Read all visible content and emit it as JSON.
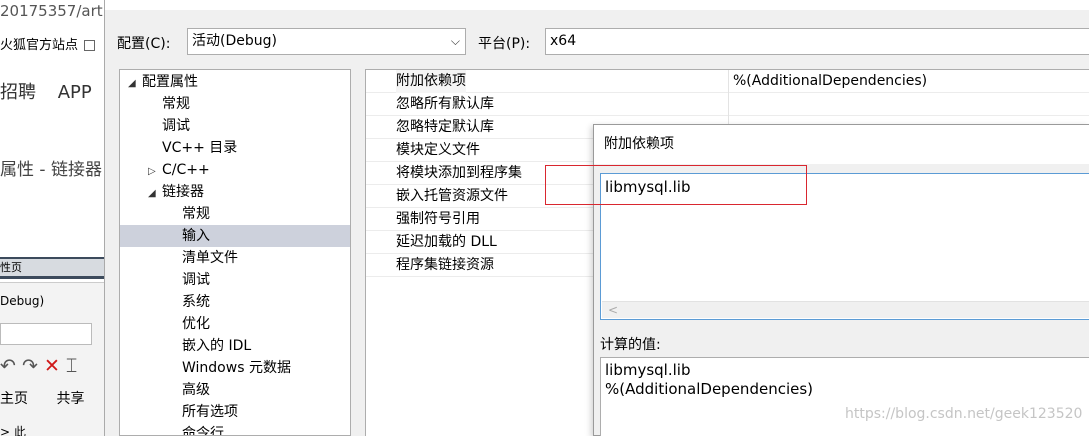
{
  "background": {
    "url_fragment": "20175357/art",
    "bookmark": "火狐官方站点",
    "nav": [
      "招聘",
      "APP"
    ],
    "heading": "属性 - 链接器",
    "darkbar_title": "性页",
    "debug_text": "Debug)",
    "ribbon": [
      "主页",
      "共享"
    ],
    "address": "> 此"
  },
  "toolbar": {
    "config_label": "配置(C):",
    "config_value": "活动(Debug)",
    "platform_label": "平台(P):",
    "platform_value": "x64"
  },
  "tree": {
    "items": [
      {
        "label": "配置属性",
        "expander": "◢",
        "level": 0
      },
      {
        "label": "常规",
        "expander": "",
        "level": 1
      },
      {
        "label": "调试",
        "expander": "",
        "level": 1
      },
      {
        "label": "VC++ 目录",
        "expander": "",
        "level": 1
      },
      {
        "label": "C/C++",
        "expander": "▷",
        "level": 1
      },
      {
        "label": "链接器",
        "expander": "◢",
        "level": 1
      },
      {
        "label": "常规",
        "expander": "",
        "level": 2
      },
      {
        "label": "输入",
        "expander": "",
        "level": 2,
        "selected": true
      },
      {
        "label": "清单文件",
        "expander": "",
        "level": 2
      },
      {
        "label": "调试",
        "expander": "",
        "level": 2
      },
      {
        "label": "系统",
        "expander": "",
        "level": 2
      },
      {
        "label": "优化",
        "expander": "",
        "level": 2
      },
      {
        "label": "嵌入的 IDL",
        "expander": "",
        "level": 2
      },
      {
        "label": "Windows 元数据",
        "expander": "",
        "level": 2
      },
      {
        "label": "高级",
        "expander": "",
        "level": 2
      },
      {
        "label": "所有选项",
        "expander": "",
        "level": 2
      },
      {
        "label": "命令行",
        "expander": "",
        "level": 2
      }
    ]
  },
  "grid": {
    "rows": [
      {
        "name": "附加依赖项",
        "value": "%(AdditionalDependencies)",
        "selected": true
      },
      {
        "name": "忽略所有默认库",
        "value": ""
      },
      {
        "name": "忽略特定默认库",
        "value": ""
      },
      {
        "name": "模块定义文件",
        "value": ""
      },
      {
        "name": "将模块添加到程序集",
        "value": ""
      },
      {
        "name": "嵌入托管资源文件",
        "value": ""
      },
      {
        "name": "强制符号引用",
        "value": ""
      },
      {
        "name": "延迟加载的 DLL",
        "value": ""
      },
      {
        "name": "程序集链接资源",
        "value": ""
      }
    ]
  },
  "subdialog": {
    "title": "附加依赖项",
    "edit_text": "libmysql.lib",
    "scroll_left": "<",
    "calc_label": "计算的值:",
    "calc_lines": [
      "libmysql.lib",
      "%(AdditionalDependencies)"
    ]
  },
  "watermark": "https://blog.csdn.net/geek123520",
  "colors": {
    "selection": "#cdd1dc",
    "highlight_box": "#d9272f",
    "edit_focus_border": "#5b9bd5"
  }
}
